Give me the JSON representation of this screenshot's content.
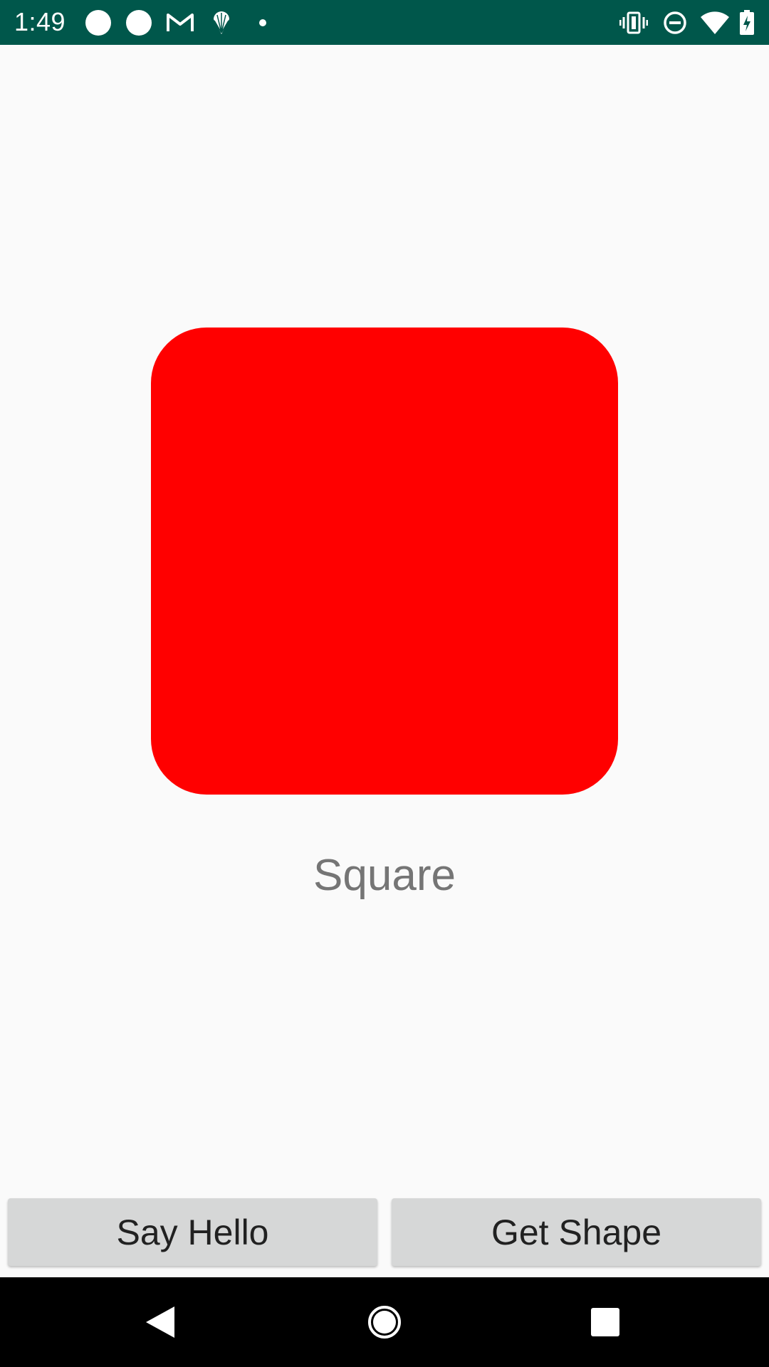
{
  "status_bar": {
    "time": "1:49",
    "background": "#00574B",
    "notification_icons": [
      "circle-icon",
      "circle-icon",
      "gmail-icon",
      "shell-icon",
      "dot-icon"
    ],
    "system_icons": [
      "vibrate-icon",
      "do-not-disturb-icon",
      "wifi-icon",
      "battery-charging-icon"
    ]
  },
  "main": {
    "shape": {
      "kind": "rounded-square",
      "color": "#FF0000"
    },
    "shape_label": "Square"
  },
  "buttons": {
    "say_hello": "Say Hello",
    "get_shape": "Get Shape"
  },
  "nav_bar": {
    "icons": [
      "back-icon",
      "home-icon",
      "recents-icon"
    ]
  },
  "colors": {
    "background": "#FAFAFA",
    "button": "#D6D7D7",
    "label_text": "#757575"
  }
}
